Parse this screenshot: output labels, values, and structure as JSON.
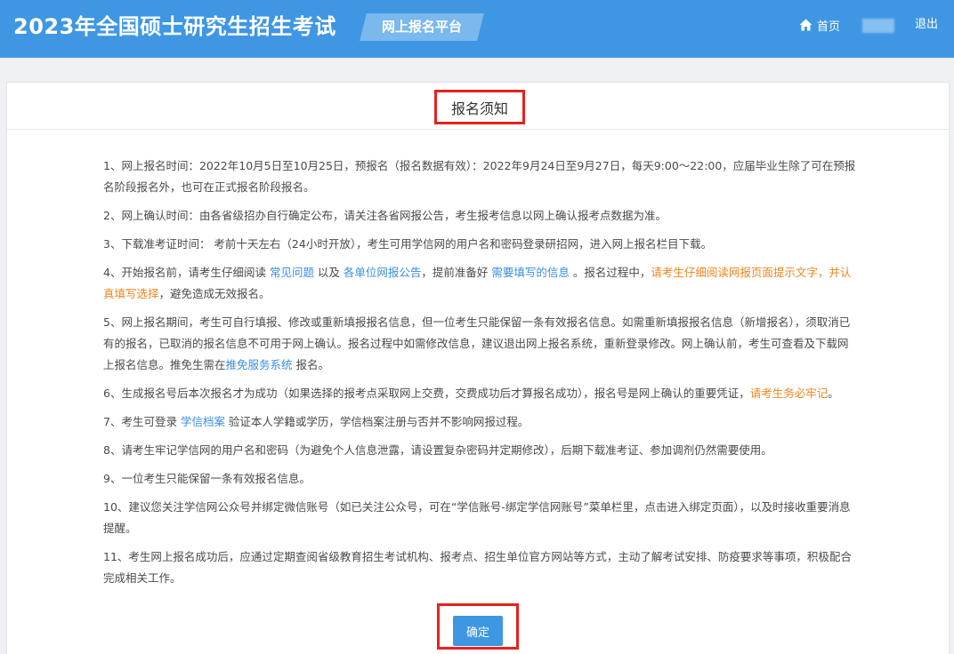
{
  "header": {
    "site_title": "2023年全国硕士研究生招生考试",
    "platform_label": "网上报名平台",
    "nav_home": "首页",
    "nav_logout": "退出",
    "home_icon": "home-icon"
  },
  "panel": {
    "title": "报名须知"
  },
  "notices": [
    {
      "parts": [
        {
          "t": "1、网上报名时间：2022年10月5日至10月25日，预报名（报名数据有效）：2022年9月24日至9月27日，每天9:00～22:00，应届毕业生除了可在预报名阶段报名外，也可在正式报名阶段报名。"
        }
      ]
    },
    {
      "parts": [
        {
          "t": "2、网上确认时间：由各省级招办自行确定公布，请关注各省网报公告，考生报考信息以网上确认报考点数据为准。"
        }
      ]
    },
    {
      "parts": [
        {
          "t": "3、下载准考证时间： 考前十天左右（24小时开放），考生可用学信网的用户名和密码登录研招网，进入网上报名栏目下载。"
        }
      ]
    },
    {
      "parts": [
        {
          "t": "4、开始报名前，请考生仔细阅读 "
        },
        {
          "t": "常见问题",
          "type": "link"
        },
        {
          "t": " 以及 "
        },
        {
          "t": "各单位网报公告",
          "type": "link"
        },
        {
          "t": "，提前准备好 "
        },
        {
          "t": "需要填写的信息",
          "type": "link"
        },
        {
          "t": " 。报名过程中，"
        },
        {
          "t": "请考生仔细阅读网报页面提示文字，并认真填写选择",
          "type": "warn"
        },
        {
          "t": "，避免造成无效报名。"
        }
      ]
    },
    {
      "parts": [
        {
          "t": "5、网上报名期间，考生可自行填报、修改或重新填报报名信息，但一位考生只能保留一条有效报名信息。如需重新填报报名信息（新增报名），须取消已有的报名，已取消的报名信息不可用于网上确认。报名过程中如需修改信息，建议退出网上报名系统，重新登录修改。网上确认前，考生可查看及下载网上报名信息。推免生需在"
        },
        {
          "t": "推免服务系统",
          "type": "link"
        },
        {
          "t": " 报名。"
        }
      ]
    },
    {
      "parts": [
        {
          "t": "6、生成报名号后本次报名才为成功（如果选择的报考点采取网上交费，交费成功后才算报名成功），报名号是网上确认的重要凭证，"
        },
        {
          "t": "请考生务必牢记",
          "type": "warn"
        },
        {
          "t": "。"
        }
      ]
    },
    {
      "parts": [
        {
          "t": "7、考生可登录 "
        },
        {
          "t": "学信档案",
          "type": "link"
        },
        {
          "t": " 验证本人学籍或学历，学信档案注册与否并不影响网报过程。"
        }
      ]
    },
    {
      "parts": [
        {
          "t": "8、请考生牢记学信网的用户名和密码（为避免个人信息泄露，请设置复杂密码并定期修改），后期下载准考证、参加调剂仍然需要使用。"
        }
      ]
    },
    {
      "parts": [
        {
          "t": "9、一位考生只能保留一条有效报名信息。"
        }
      ]
    },
    {
      "parts": [
        {
          "t": "10、建议您关注学信网公众号并绑定微信账号（如已关注公众号，可在“学信账号-绑定学信网账号”菜单栏里，点击进入绑定页面），以及时接收重要消息提醒。"
        }
      ]
    },
    {
      "parts": [
        {
          "t": "11、考生网上报名成功后，应通过定期查阅省级教育招生考试机构、报考点、招生单位官方网站等方式，主动了解考试安排、防疫要求等事项，积极配合完成相关工作。"
        }
      ]
    }
  ],
  "confirm": {
    "label": "确定"
  },
  "colors": {
    "header_bg": "#3f97e4",
    "link": "#3a8ee6",
    "warning": "#f0851d",
    "highlight_border": "#e8211d"
  }
}
